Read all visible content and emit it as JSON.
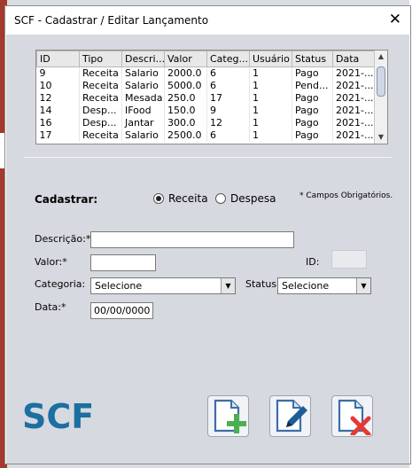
{
  "window": {
    "title": "SCF - Cadastrar / Editar Lançamento"
  },
  "table": {
    "columns": [
      "ID",
      "Tipo",
      "Descri...",
      "Valor",
      "Categ...",
      "Usuário",
      "Status",
      "Data"
    ],
    "rows": [
      [
        "9",
        "Receita",
        "Salario",
        "2000.0",
        "6",
        "1",
        "Pago",
        "2021-..."
      ],
      [
        "10",
        "Receita",
        "Salario",
        "5000.0",
        "6",
        "1",
        "Pend...",
        "2021-..."
      ],
      [
        "12",
        "Receita",
        "Mesada",
        "250.0",
        "17",
        "1",
        "Pago",
        "2021-..."
      ],
      [
        "14",
        "Desp...",
        "IFood",
        "150.0",
        "9",
        "1",
        "Pago",
        "2021-..."
      ],
      [
        "16",
        "Desp...",
        "Jantar",
        "300.0",
        "12",
        "1",
        "Pago",
        "2021-..."
      ],
      [
        "17",
        "Receita",
        "Salario",
        "2500.0",
        "6",
        "1",
        "Pago",
        "2021-..."
      ]
    ]
  },
  "form": {
    "cadastrar_label": "Cadastrar:",
    "radio_receita": "Receita",
    "radio_despesa": "Despesa",
    "required_note": "* Campos Obrigatórios.",
    "descricao_label": "Descrição:*",
    "descricao_value": "",
    "valor_label": "Valor:*",
    "valor_value": "",
    "id_label": "ID:",
    "categoria_label": "Categoria:",
    "categoria_value": "Selecione",
    "status_label": "Status:",
    "status_value": "Selecione",
    "data_label": "Data:*",
    "data_value": "00/00/0000"
  },
  "logo": {
    "text": "SCF"
  },
  "colors": {
    "logo_blue": "#1b6fa1",
    "add_green": "#4caf50",
    "delete_red": "#e53935",
    "edit_blue": "#1f5d99"
  },
  "actions": {
    "add_icon": "add-document-icon",
    "edit_icon": "edit-document-icon",
    "delete_icon": "delete-document-icon"
  }
}
